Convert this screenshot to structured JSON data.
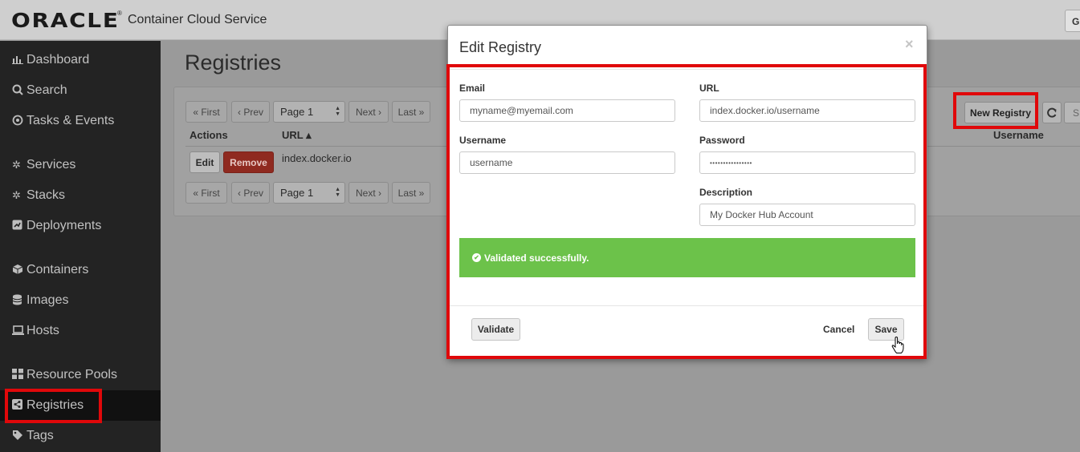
{
  "header": {
    "brand": "ORACLE",
    "trademark": "®",
    "app_title": "Container Cloud Service",
    "right_button": "G"
  },
  "sidebar": {
    "items": [
      {
        "label": "Dashboard",
        "icon": "bar-chart-icon"
      },
      {
        "label": "Search",
        "icon": "search-icon"
      },
      {
        "label": "Tasks & Events",
        "icon": "target-icon"
      },
      {
        "label": "Services",
        "icon": "gear-icon"
      },
      {
        "label": "Stacks",
        "icon": "gears-icon"
      },
      {
        "label": "Deployments",
        "icon": "deploy-icon"
      },
      {
        "label": "Containers",
        "icon": "cube-icon"
      },
      {
        "label": "Images",
        "icon": "database-icon"
      },
      {
        "label": "Hosts",
        "icon": "laptop-icon"
      },
      {
        "label": "Resource Pools",
        "icon": "grid-icon"
      },
      {
        "label": "Registries",
        "icon": "share-icon"
      },
      {
        "label": "Tags",
        "icon": "tag-icon"
      }
    ],
    "active": "Registries"
  },
  "page": {
    "title": "Registries",
    "pager": {
      "first": "« First",
      "prev": "‹ Prev",
      "page": "Page 1",
      "next": "Next ›",
      "last": "Last »"
    },
    "columns": {
      "actions": "Actions",
      "url": "URL ▴",
      "username": "Username"
    },
    "rows": [
      {
        "url": "index.docker.io",
        "edit": "Edit",
        "remove": "Remove"
      }
    ],
    "new_registry": "New Registry",
    "extra_button": "S"
  },
  "modal": {
    "title": "Edit Registry",
    "close": "×",
    "email_label": "Email",
    "email_value": "myname@myemail.com",
    "url_label": "URL",
    "url_value": "index.docker.io/username",
    "username_label": "Username",
    "username_value": "username",
    "password_label": "Password",
    "password_value": "••••••••••••••••",
    "description_label": "Description",
    "description_value": "My Docker Hub Account",
    "alert": "Validated successfully.",
    "validate": "Validate",
    "cancel": "Cancel",
    "save": "Save"
  },
  "colors": {
    "highlight": "#e0080a",
    "success": "#6cc24a",
    "danger": "#8f2a20"
  }
}
